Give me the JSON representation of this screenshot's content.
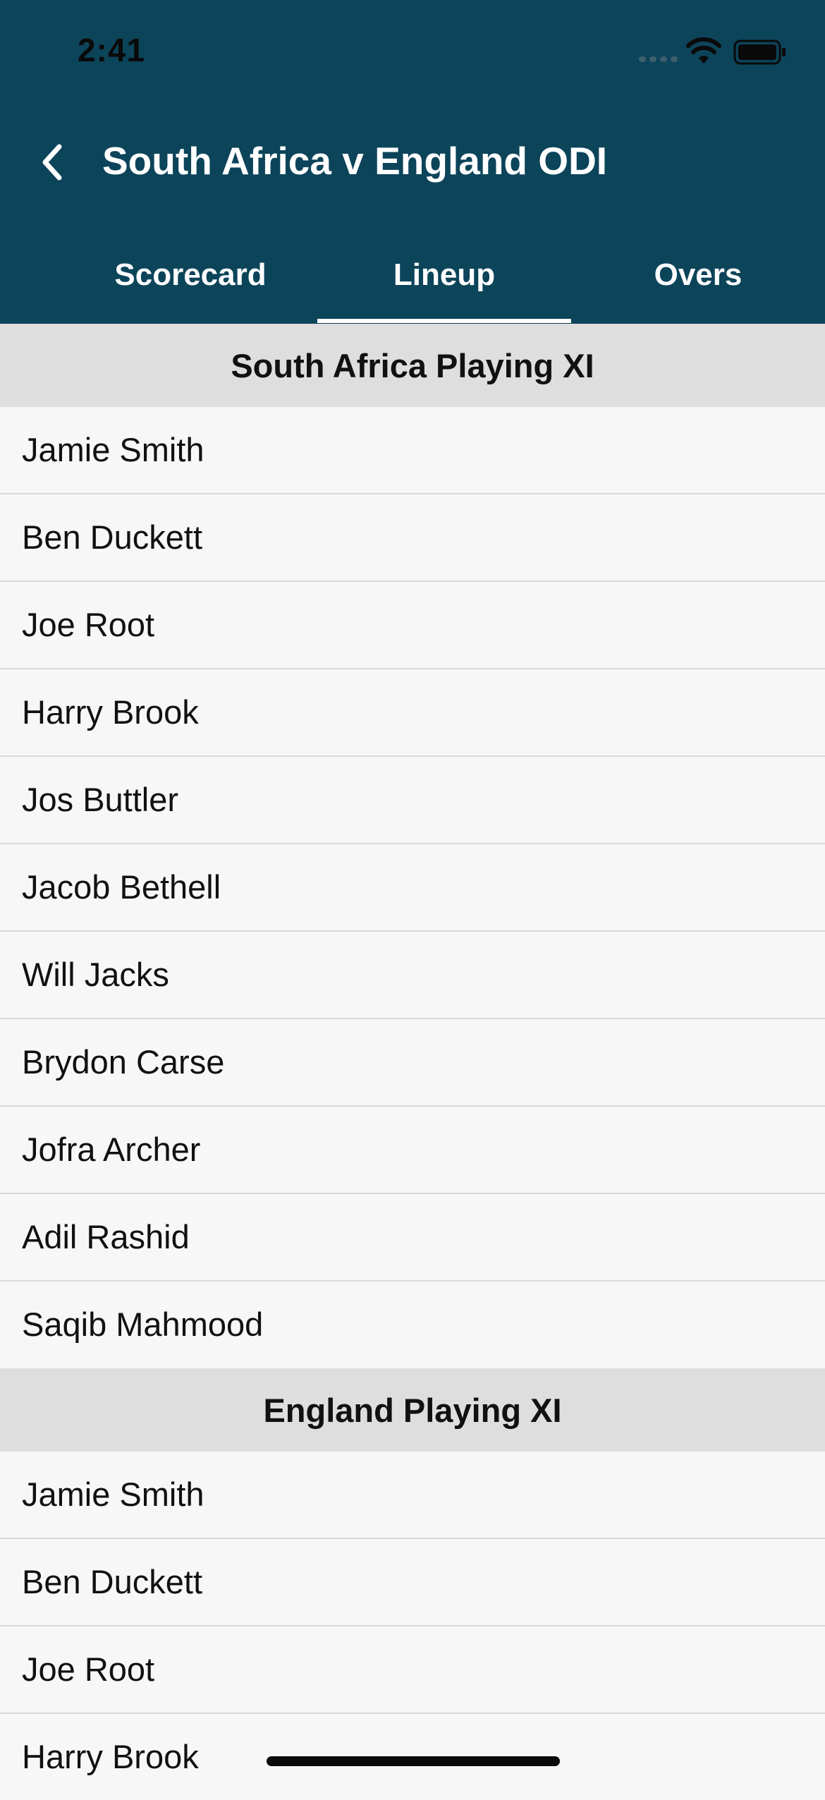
{
  "status_bar": {
    "time": "2:41",
    "icons": [
      "cellular-signal-icon",
      "wifi-icon",
      "battery-icon"
    ]
  },
  "nav": {
    "back_icon": "chevron-left-icon",
    "title": "South Africa v England ODI"
  },
  "tabs": [
    {
      "label": "Scorecard",
      "selected": false
    },
    {
      "label": "Lineup",
      "selected": true
    },
    {
      "label": "Overs",
      "selected": false
    }
  ],
  "sections": [
    {
      "title": "South Africa Playing XI",
      "players": [
        "Jamie Smith",
        "Ben Duckett",
        "Joe Root",
        "Harry Brook",
        "Jos Buttler",
        "Jacob Bethell",
        "Will Jacks",
        "Brydon Carse",
        "Jofra Archer",
        "Adil Rashid",
        "Saqib Mahmood"
      ]
    },
    {
      "title": "England Playing XI",
      "players": [
        "Jamie Smith",
        "Ben Duckett",
        "Joe Root",
        "Harry Brook"
      ]
    }
  ],
  "colors": {
    "header_background": "#0c445a",
    "section_header_background": "#dedede",
    "row_background": "#f7f7f7",
    "divider": "#d9d9d9",
    "text": "#111111",
    "header_text": "#ffffff"
  }
}
